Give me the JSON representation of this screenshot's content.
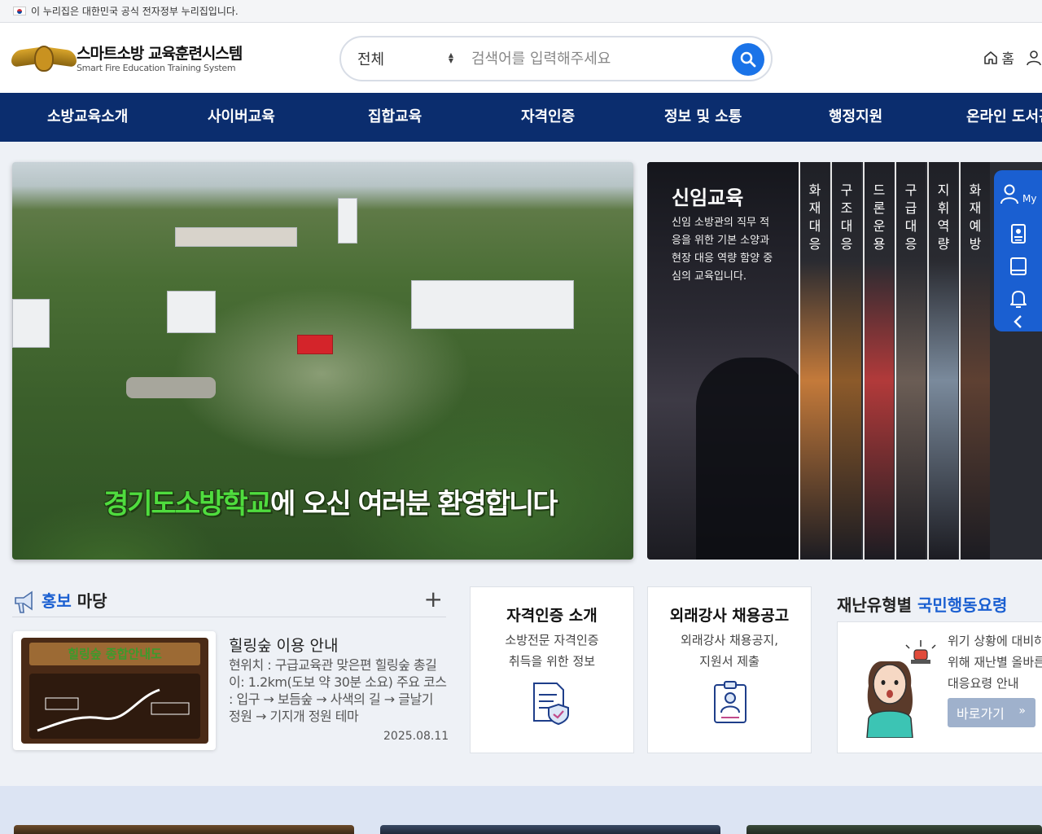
{
  "gov_bar": {
    "text": "이 누리집은 대한민국 공식 전자정부 누리집입니다."
  },
  "logo": {
    "title": "스마트소방 교육훈련시스템",
    "subtitle": "Smart Fire Education Training  System"
  },
  "search": {
    "scope": "전체",
    "placeholder": "검색어를 입력해주세요",
    "value": ""
  },
  "util": {
    "home": "홈"
  },
  "nav": [
    "소방교육소개",
    "사이버교육",
    "집합교육",
    "자격인증",
    "정보 및 소통",
    "행정지원",
    "온라인 도서관"
  ],
  "hero": {
    "caption_highlight": "경기도소방학교",
    "caption_rest": "에 오신 여러분 환영합니다"
  },
  "education": {
    "title": "신임교육",
    "description": "신임 소방관의 직무 적응을 위한 기본 소양과 현장 대응 역량 함양 중심의 교육입니다.",
    "strips": [
      "화재대응",
      "구조대응",
      "드론운용",
      "구급대응",
      "지휘역량",
      "화재예방"
    ],
    "strip_colors": [
      "#c47a3a",
      "#8c5a2a",
      "#b23a3a",
      "#6b5d55",
      "#7a8a9c",
      "#5e4032"
    ]
  },
  "quick": {
    "my_label": "My"
  },
  "promo": {
    "title_blue": "홍보",
    "title_rest": " 마당",
    "more": "+",
    "image_label": "힐링숲 종합안내도",
    "item_title": "힐링숲 이용 안내",
    "item_desc": "현위치 : 구급교육관 맞은편 힐링숲 총길이: 1.2km(도보 약 30분 소요) 주요 코스 : 입구 → 보듬숲 → 사색의 길 → 글날기 정원 → 기지개 정원 테마",
    "item_date": "2025.08.11"
  },
  "cards": [
    {
      "title": "자격인증 소개",
      "desc": [
        "소방전문 자격인증",
        "취득을 위한 정보"
      ],
      "icon": "certificate-icon"
    },
    {
      "title": "외래강사 채용공고",
      "desc": [
        "외래강사 채용공지,",
        "지원서 제출"
      ],
      "icon": "instructor-icon"
    }
  ],
  "disaster": {
    "title_rest": "재난유형별 ",
    "title_blue": "국민행동요령",
    "desc": [
      "위기 상황에 대비하기",
      "위해 재난별 올바른",
      "대응요령 안내"
    ],
    "button": "바로가기",
    "chevron": "»"
  },
  "colors": {
    "nav_bg": "#0b2d6e",
    "accent": "#1a5fd1",
    "search_btn": "#1a73e8"
  }
}
